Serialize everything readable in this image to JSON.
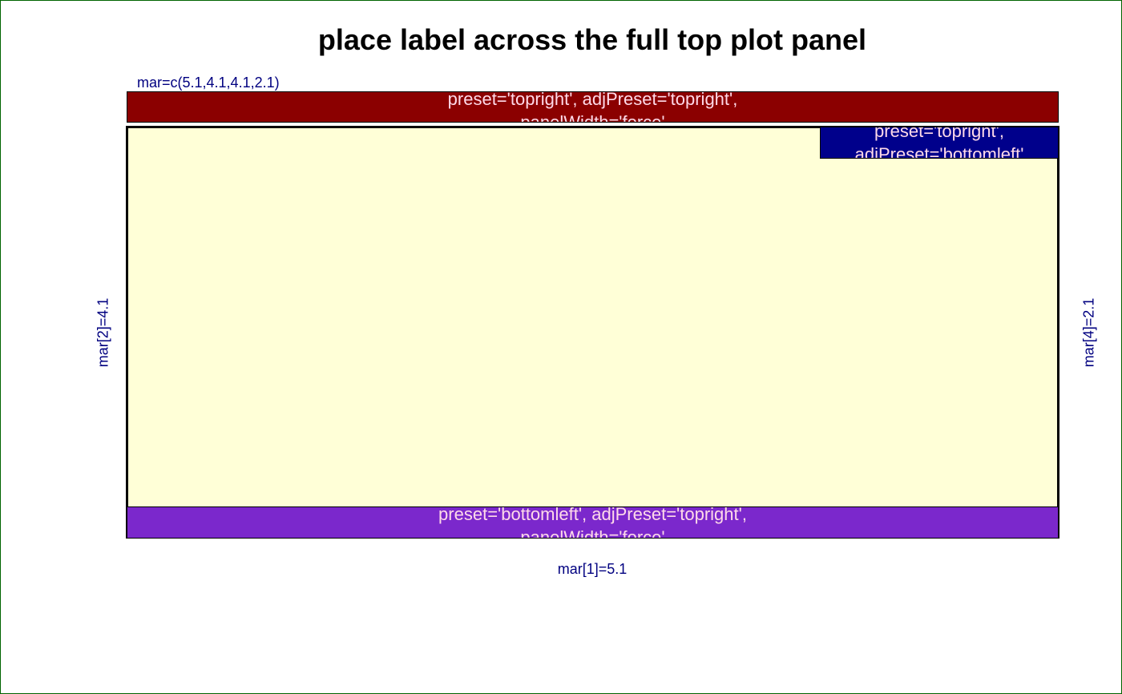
{
  "title": "place label across the full top plot panel",
  "margins": {
    "top_label": "mar=c(5.1,4.1,4.1,2.1)",
    "bottom_label": "mar[1]=5.1",
    "left_label": "mar[2]=4.1",
    "right_label": "mar[4]=2.1"
  },
  "labels": {
    "top_full": {
      "line1": "preset='topright', adjPreset='topright',",
      "line2": "panelWidth='force'",
      "fill": "#8b0000"
    },
    "top_right": {
      "line1": "preset='topright',",
      "line2": "adjPreset='bottomleft'",
      "fill": "#00008b"
    },
    "bottom_full": {
      "line1": "preset='bottomleft', adjPreset='topright',",
      "line2": "panelWidth='force'",
      "fill": "#7b28cc"
    }
  },
  "colors": {
    "plot_background": "#ffffd7",
    "margin_text": "#000080",
    "label_text": "#ffdae9",
    "figure_border": "#006400"
  }
}
